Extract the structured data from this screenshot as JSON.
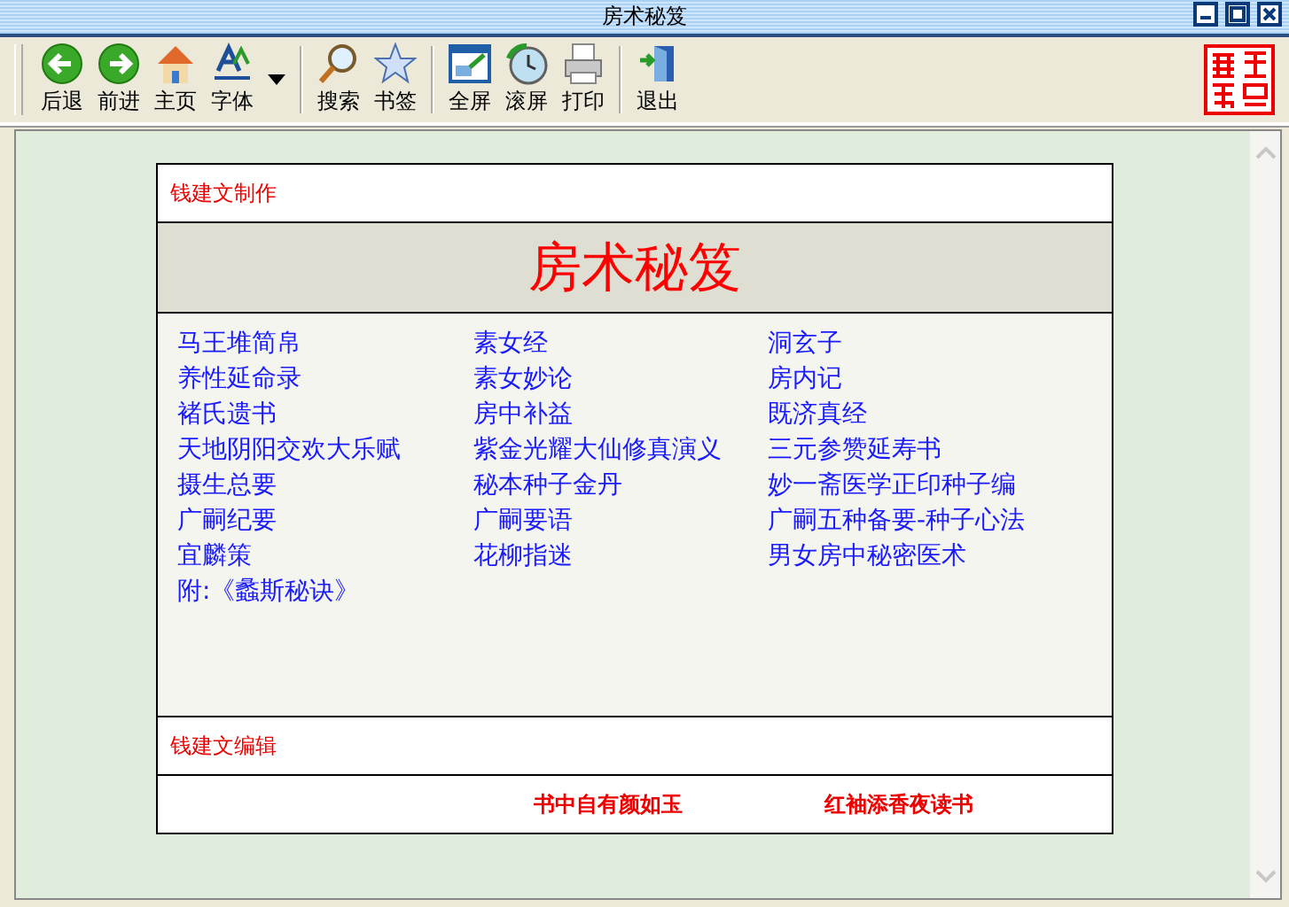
{
  "window": {
    "title": "房术秘笈"
  },
  "toolbar": {
    "groups": [
      {
        "buttons": [
          {
            "label": "后退"
          },
          {
            "label": "前进"
          },
          {
            "label": "主页"
          },
          {
            "label": "字体"
          }
        ]
      },
      {
        "buttons": [
          {
            "label": "搜索"
          },
          {
            "label": "书签"
          }
        ]
      },
      {
        "buttons": [
          {
            "label": "全屏"
          },
          {
            "label": "滚屏"
          },
          {
            "label": "打印"
          }
        ]
      },
      {
        "buttons": [
          {
            "label": "退出"
          }
        ]
      }
    ]
  },
  "page": {
    "header": "钱建文制作",
    "title": "房术秘笈",
    "links": [
      [
        "马王堆简帛",
        "素女经",
        "洞玄子"
      ],
      [
        "养性延命录",
        "素女妙论",
        "房内记"
      ],
      [
        "褚氏遗书",
        "房中补益",
        "既济真经"
      ],
      [
        "天地阴阳交欢大乐赋",
        "紫金光耀大仙修真演义",
        "三元参赞延寿书"
      ],
      [
        "摄生总要",
        "秘本种子金丹",
        "妙一斋医学正印种子编"
      ],
      [
        "广嗣纪要",
        "广嗣要语",
        "广嗣五种备要-种子心法"
      ],
      [
        "宜麟策",
        "花柳指迷",
        "男女房中秘密医术"
      ],
      [
        "附:《蠡斯秘诀》"
      ]
    ],
    "editor": "钱建文编辑",
    "mottos": [
      "书中自有颜如玉",
      "红袖添香夜读书"
    ]
  }
}
